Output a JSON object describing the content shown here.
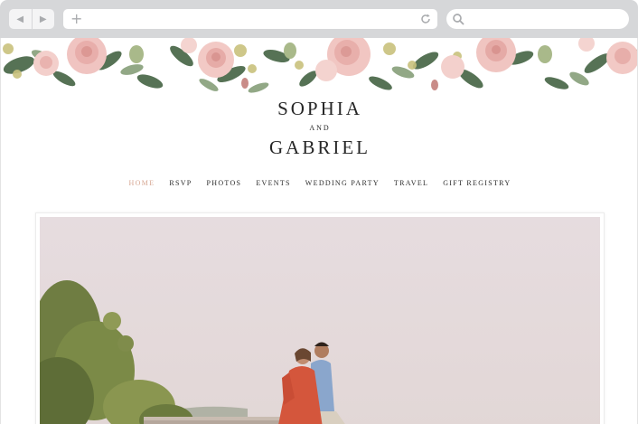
{
  "browser": {
    "back_icon": "back-arrow-icon",
    "forward_icon": "forward-arrow-icon",
    "new_tab_icon": "plus-icon",
    "reload_icon": "refresh-icon",
    "search_icon": "search-icon",
    "address_value": "",
    "search_value": ""
  },
  "site": {
    "name_first": "SOPHIA",
    "conjunction": "AND",
    "name_second": "GABRIEL",
    "nav": [
      {
        "label": "HOME",
        "active": true
      },
      {
        "label": "RSVP",
        "active": false
      },
      {
        "label": "PHOTOS",
        "active": false
      },
      {
        "label": "EVENTS",
        "active": false
      },
      {
        "label": "WEDDING PARTY",
        "active": false
      },
      {
        "label": "TRAVEL",
        "active": false
      },
      {
        "label": "GIFT REGISTRY",
        "active": false
      }
    ],
    "accent_color": "#d7a894",
    "text_color": "#262626"
  }
}
